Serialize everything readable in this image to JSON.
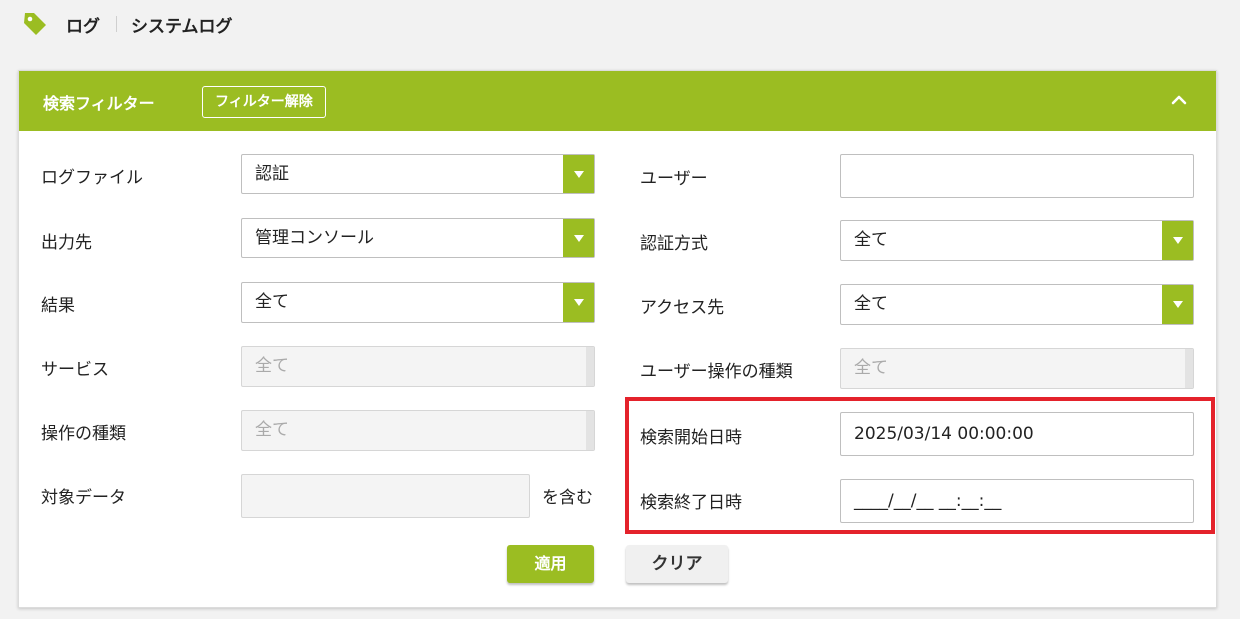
{
  "breadcrumb": {
    "icon": "tag-icon",
    "items": [
      "ログ",
      "システムログ"
    ]
  },
  "filter": {
    "title": "検索フィルター",
    "clear_filter_label": "フィルター解除",
    "collapse_icon": "chevron-up-icon",
    "left": {
      "log_file": {
        "label": "ログファイル",
        "value": "認証"
      },
      "destination": {
        "label": "出力先",
        "value": "管理コンソール"
      },
      "result": {
        "label": "結果",
        "value": "全て"
      },
      "service": {
        "label": "サービス",
        "value": "全て"
      },
      "operation_type": {
        "label": "操作の種類",
        "value": "全て"
      },
      "target_data": {
        "label": "対象データ",
        "value": "",
        "suffix": "を含む"
      }
    },
    "right": {
      "user": {
        "label": "ユーザー",
        "value": ""
      },
      "auth_method": {
        "label": "認証方式",
        "value": "全て"
      },
      "access_dest": {
        "label": "アクセス先",
        "value": "全て"
      },
      "user_operation_type": {
        "label": "ユーザー操作の種類",
        "value": "全て"
      },
      "search_start": {
        "label": "検索開始日時",
        "value": "2025/03/14 00:00:00"
      },
      "search_end": {
        "label": "検索終了日時",
        "value": "____/__/__ __:__:__"
      }
    },
    "apply_label": "適用",
    "clear_label": "クリア"
  },
  "colors": {
    "accent": "#9bbd22",
    "highlight": "#e4222b"
  }
}
